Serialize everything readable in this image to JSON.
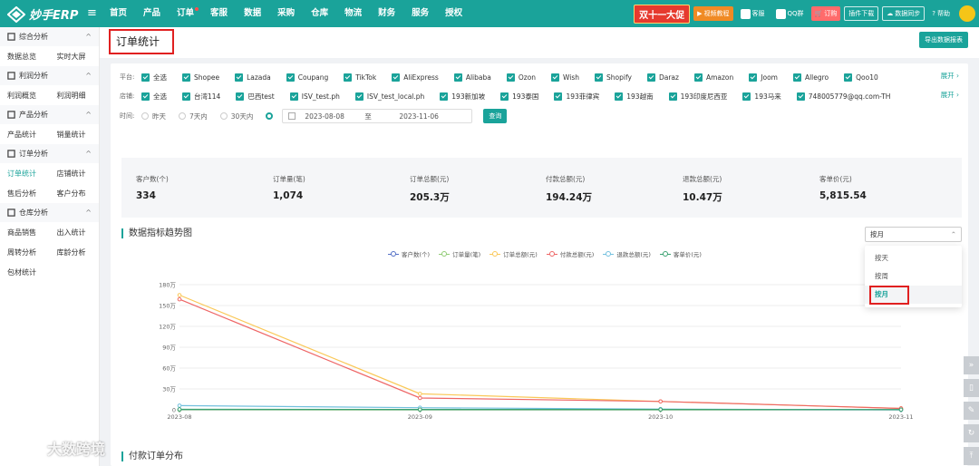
{
  "app": {
    "logo_text": "妙手ERP"
  },
  "nav": [
    {
      "label": "首页",
      "dot": false
    },
    {
      "label": "产品",
      "dot": false
    },
    {
      "label": "订单",
      "dot": true
    },
    {
      "label": "客服",
      "dot": false
    },
    {
      "label": "数据",
      "dot": false
    },
    {
      "label": "采购",
      "dot": false
    },
    {
      "label": "仓库",
      "dot": false
    },
    {
      "label": "物流",
      "dot": false
    },
    {
      "label": "财务",
      "dot": false
    },
    {
      "label": "服务",
      "dot": false
    },
    {
      "label": "授权",
      "dot": false
    }
  ],
  "toolbar": {
    "promo": "双十一大促",
    "video": "视频教程",
    "service": "客服",
    "qq": "QQ群",
    "order": "订购",
    "plugin": "插件下载",
    "sync": "数据同步",
    "help": "帮助"
  },
  "sidebar": {
    "sections": [
      {
        "title": "综合分析",
        "icon": "dashboard-icon",
        "items": [
          "数据总览",
          "实时大屏"
        ]
      },
      {
        "title": "利润分析",
        "icon": "profit-icon",
        "items": [
          "利润概览",
          "利润明细"
        ]
      },
      {
        "title": "产品分析",
        "icon": "product-icon",
        "items": [
          "产品统计",
          "销量统计"
        ]
      },
      {
        "title": "订单分析",
        "icon": "bar-chart-icon",
        "items": [
          "订单统计",
          "店铺统计",
          "售后分析",
          "客户分布"
        ]
      },
      {
        "title": "仓库分析",
        "icon": "warehouse-icon",
        "items": [
          "商品销售",
          "出入统计",
          "周转分析",
          "库龄分析",
          "包材统计"
        ]
      }
    ],
    "active": "订单统计"
  },
  "page": {
    "title": "订单统计",
    "export_label": "导出数据报表"
  },
  "filters": {
    "platform_label": "平台:",
    "platforms": [
      "全选",
      "Shopee",
      "Lazada",
      "Coupang",
      "TikTok",
      "AliExpress",
      "Alibaba",
      "Ozon",
      "Wish",
      "Shopify",
      "Daraz",
      "Amazon",
      "Joom",
      "Allegro",
      "Qoo10"
    ],
    "shop_label": "店铺:",
    "shops": [
      "全选",
      "台湾114",
      "巴西test",
      "ISV_test.ph",
      "ISV_test_local.ph",
      "193新加坡",
      "193泰国",
      "193菲律宾",
      "193越南",
      "193印度尼西亚",
      "193马来",
      "748005779@qq.com-TH"
    ],
    "expand": "展开",
    "time_label": "时间:",
    "time_options": [
      "昨天",
      "7天内",
      "30天内"
    ],
    "date_start": "2023-08-08",
    "date_sep": "至",
    "date_end": "2023-11-06",
    "query": "查询"
  },
  "stats": [
    {
      "label": "客户数(个)",
      "value": "334"
    },
    {
      "label": "订单量(笔)",
      "value": "1,074"
    },
    {
      "label": "订单总额(元)",
      "value": "205.3万"
    },
    {
      "label": "付款总额(元)",
      "value": "194.24万"
    },
    {
      "label": "退款总额(元)",
      "value": "10.47万"
    },
    {
      "label": "客单价(元)",
      "value": "5,815.54"
    }
  ],
  "trend": {
    "title": "数据指标趋势图",
    "period_selected": "按月",
    "period_options": [
      "按天",
      "按周",
      "按月"
    ]
  },
  "chart_data": {
    "type": "line",
    "x": [
      "2023-08",
      "2023-09",
      "2023-10",
      "2023-11"
    ],
    "ylim": [
      0,
      1800000
    ],
    "yticks": [
      0,
      300000,
      600000,
      900000,
      1200000,
      1500000,
      1800000
    ],
    "ytick_labels": [
      "0",
      "30万",
      "60万",
      "90万",
      "120万",
      "150万",
      "180万"
    ],
    "series": [
      {
        "name": "客户数(个)",
        "color": "#5470c6",
        "values": [
          220,
          60,
          40,
          14
        ]
      },
      {
        "name": "订单量(笔)",
        "color": "#91cc75",
        "values": [
          700,
          200,
          130,
          44
        ]
      },
      {
        "name": "订单总额(元)",
        "color": "#fac858",
        "values": [
          1650000,
          230000,
          120000,
          20000
        ]
      },
      {
        "name": "付款总额(元)",
        "color": "#ee6666",
        "values": [
          1590000,
          170000,
          120000,
          20000
        ]
      },
      {
        "name": "退款总额(元)",
        "color": "#73c0de",
        "values": [
          60000,
          30000,
          10000,
          0
        ]
      },
      {
        "name": "客单价(元)",
        "color": "#3ba272",
        "values": [
          7000,
          5000,
          5000,
          3000
        ]
      }
    ]
  },
  "bottom": {
    "title": "付款订单分布"
  },
  "watermark": "大数跨境"
}
